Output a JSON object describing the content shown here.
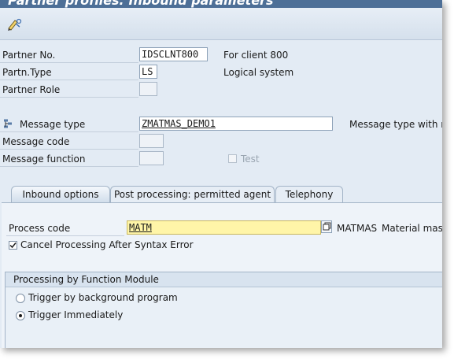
{
  "window": {
    "title": "Partner profiles: Inbound parameters"
  },
  "toolbar": {
    "icon": "display-change-icon"
  },
  "header_fields": {
    "partner_no": {
      "label": "Partner No.",
      "value": "IDSCLNT800",
      "desc": "For client 800"
    },
    "partn_type": {
      "label": "Partn.Type",
      "value": "LS",
      "desc": "Logical system"
    },
    "partner_role": {
      "label": "Partner Role",
      "value": ""
    },
    "message_type": {
      "label": "Message type",
      "value": "ZMATMAS_DEMO1",
      "desc": "Message type with ru"
    },
    "message_code": {
      "label": "Message code",
      "value": ""
    },
    "message_function": {
      "label": "Message function",
      "value": ""
    },
    "test": {
      "label": "Test",
      "checked": false
    }
  },
  "tabs": [
    {
      "label": "Inbound options",
      "active": true
    },
    {
      "label": "Post processing: permitted agent",
      "active": false
    },
    {
      "label": "Telephony",
      "active": false
    }
  ],
  "inbound": {
    "process_code": {
      "label": "Process code",
      "value": "MATM",
      "ref": "MATMAS",
      "desc": "Material maste"
    },
    "cancel_processing": {
      "label": "Cancel Processing After Syntax Error",
      "checked": true
    },
    "group": {
      "title": "Processing by Function Module",
      "options": [
        {
          "label": "Trigger by background program",
          "selected": false
        },
        {
          "label": "Trigger Immediately",
          "selected": true
        }
      ]
    }
  },
  "colors": {
    "title_bar": "#4d6f97",
    "panel_bg": "#e3ebf4",
    "required_field": "#fff5a8",
    "tab_active": "#cfdcea"
  }
}
